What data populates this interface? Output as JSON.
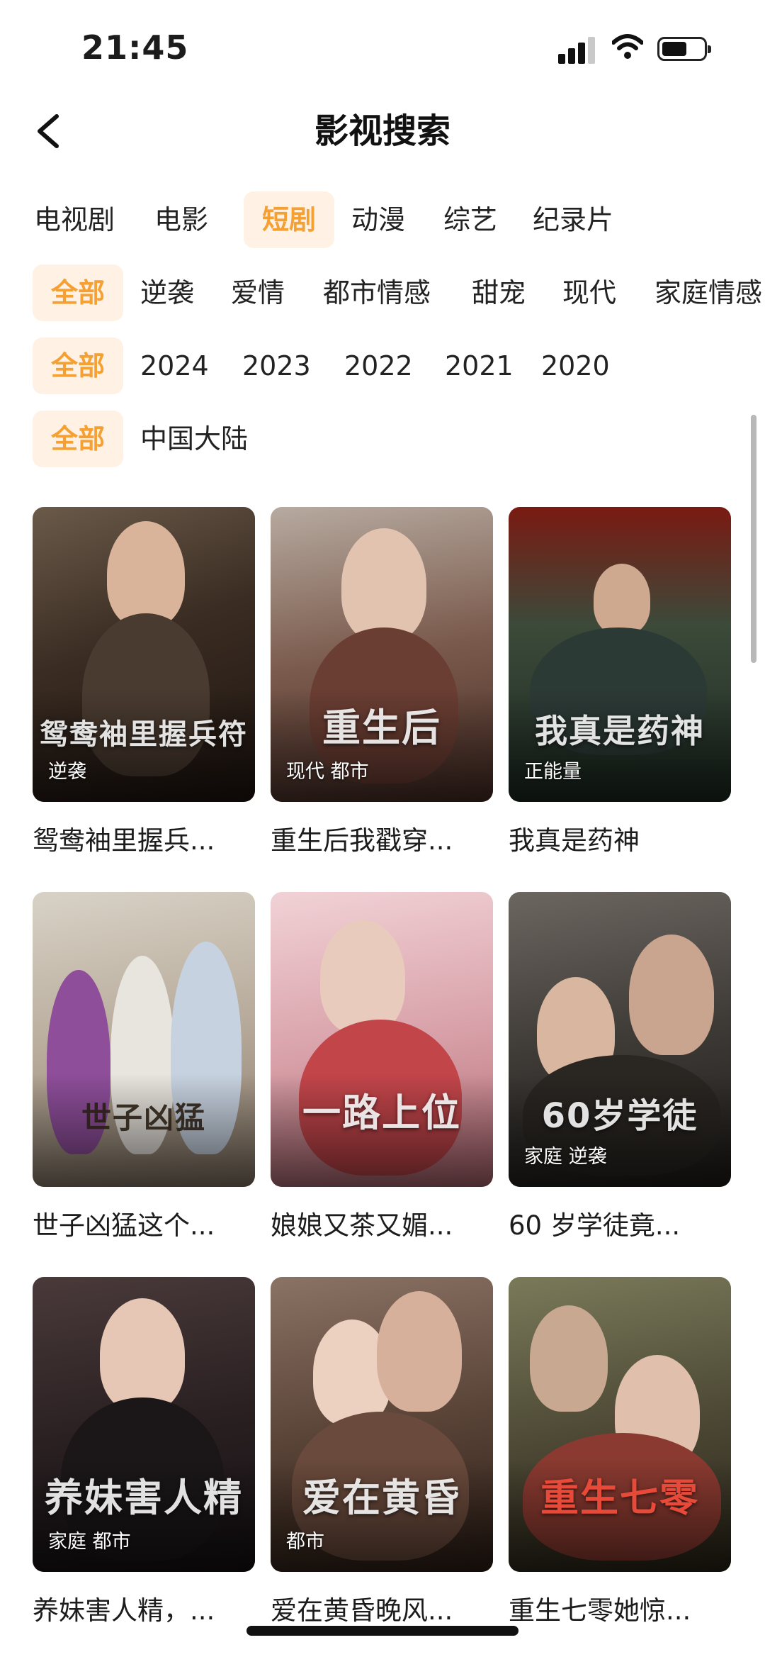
{
  "status_bar": {
    "time": "21:45"
  },
  "header": {
    "title": "影视搜索",
    "back_icon": "chevron-left-icon"
  },
  "category_tabs": [
    {
      "label": "电视剧",
      "active": false
    },
    {
      "label": "电影",
      "active": false
    },
    {
      "label": "短剧",
      "active": true
    },
    {
      "label": "动漫",
      "active": false
    },
    {
      "label": "综艺",
      "active": false
    },
    {
      "label": "纪录片",
      "active": false
    }
  ],
  "genre_filters": [
    "全部",
    "逆袭",
    "爱情",
    "都市情感",
    "甜宠",
    "现代",
    "家庭情感"
  ],
  "year_filters": [
    "全部",
    "2024",
    "2023",
    "2022",
    "2021",
    "2020"
  ],
  "region_filters": [
    "全部",
    "中国大陆"
  ],
  "active_color": "#f5a033",
  "active_bg": "#fff1e4",
  "results": [
    {
      "title": "鸳鸯袖里握兵...",
      "tags": "逆袭",
      "poster_text": "鸳鸯袖里握兵符"
    },
    {
      "title": "重生后我戳穿...",
      "tags": "现代 都市",
      "poster_text": "重生后"
    },
    {
      "title": "我真是药神",
      "tags": "正能量",
      "poster_text": "我真是药神"
    },
    {
      "title": "世子凶猛这个...",
      "tags": "",
      "poster_text": "世子凶猛"
    },
    {
      "title": "娘娘又茶又媚...",
      "tags": "",
      "poster_text": "一路上位"
    },
    {
      "title": "60 岁学徒竟...",
      "tags": "家庭 逆袭",
      "poster_text": "60岁学徒"
    },
    {
      "title": "养妹害人精，...",
      "tags": "家庭 都市",
      "poster_text": "养妹害人精"
    },
    {
      "title": "爱在黄昏晚风...",
      "tags": "都市",
      "poster_text": "爱在黄昏"
    },
    {
      "title": "重生七零她惊...",
      "tags": "",
      "poster_text": "重生七零"
    }
  ]
}
